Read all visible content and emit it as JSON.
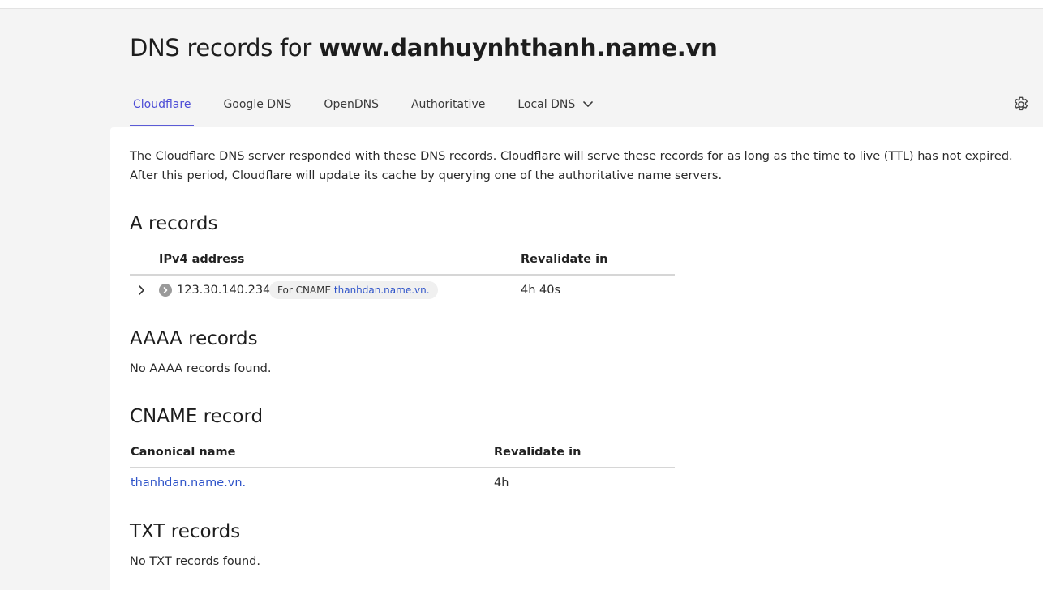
{
  "page": {
    "title_prefix": "DNS records for",
    "domain": "www.danhuynhthanh.name.vn"
  },
  "tabs": [
    {
      "label": "Cloudflare",
      "active": true
    },
    {
      "label": "Google DNS",
      "active": false
    },
    {
      "label": "OpenDNS",
      "active": false
    },
    {
      "label": "Authoritative",
      "active": false
    },
    {
      "label": "Local DNS",
      "active": false,
      "has_dropdown": true
    }
  ],
  "settings_icon": "gear-icon",
  "intro": "The Cloudflare DNS server responded with these DNS records. Cloudflare will serve these records for as long as the time to live (TTL) has not expired. After this period, Cloudflare will update its cache by querying one of the authoritative name servers.",
  "a_records": {
    "title": "A records",
    "columns": [
      "IPv4 address",
      "Revalidate in"
    ],
    "rows": [
      {
        "ip": "123.30.140.234",
        "badge_prefix": "For CNAME",
        "badge_link": "thanhdan.name.vn.",
        "revalidate": "4h 40s"
      }
    ]
  },
  "aaaa_records": {
    "title": "AAAA records",
    "empty": "No AAAA records found."
  },
  "cname_record": {
    "title": "CNAME record",
    "columns": [
      "Canonical name",
      "Revalidate in"
    ],
    "rows": [
      {
        "name": "thanhdan.name.vn.",
        "revalidate": "4h"
      }
    ]
  },
  "txt_records": {
    "title": "TXT records",
    "empty": "No TXT records found."
  },
  "colors": {
    "accent": "#5b5bd6",
    "link": "#2f54c9",
    "background": "#f4f4f4",
    "panel": "#ffffff"
  }
}
